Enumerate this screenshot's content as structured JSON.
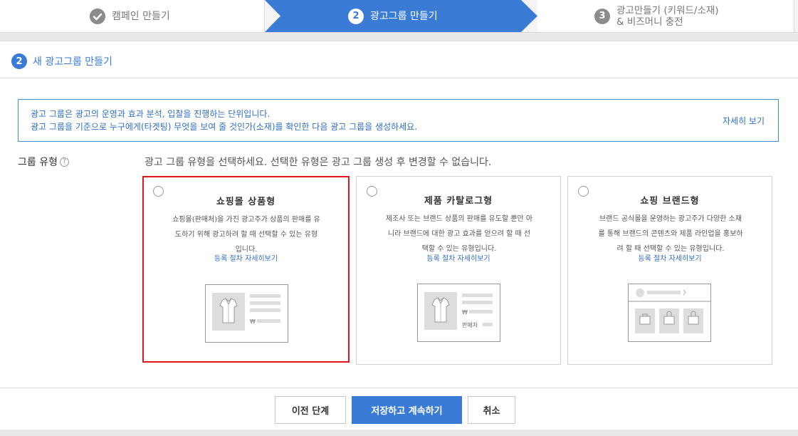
{
  "stepper": {
    "steps": [
      {
        "number": "✔",
        "label": "캠페인 만들기",
        "state": "done"
      },
      {
        "number": "2",
        "label": "광고그룹 만들기",
        "state": "active"
      },
      {
        "number": "3",
        "label_line1": "광고만들기 (키워드/소재)",
        "label_line2": "& 비즈머니 충전",
        "state": "pending"
      }
    ]
  },
  "section": {
    "number": "2",
    "title": "새 광고그룹 만들기"
  },
  "info": {
    "line1": "광고 그룹은 광고의 운영과 효과 분석, 입찰을 진행하는 단위입니다.",
    "line2": "광고 그룹을 기준으로 누구에게(타겟팅) 무엇을 보여 줄 것인가(소재)를 확인한 다음 광고 그룹을 생성하세요.",
    "detail_link": "자세히 보기"
  },
  "group_type": {
    "label": "그룹 유형",
    "help": "?",
    "description": "광고 그룹 유형을 선택하세요. 선택한 유형은 광고 그룹 생성 후 변경할 수 없습니다."
  },
  "cards": [
    {
      "title": "쇼핑몰 상품형",
      "desc_lines": [
        "쇼핑몰(판매처)을 가진 광고주가 상품의 판매를 유",
        "도하기 위해 광고하려 할 때 선택할 수 있는 유형",
        "입니다."
      ],
      "link": "등록 절차 자세히보기",
      "price_symbol": "₩",
      "highlighted": true
    },
    {
      "title": "제품 카탈로그형",
      "desc_lines": [
        "제조사 또는 브랜드 상품의 판매를 유도할 뿐만 아",
        "니라 브랜드에 대한 광고 효과를 얻으려 할 때 선",
        "택할 수 있는 유형입니다."
      ],
      "link": "등록 절차 자세히보기",
      "price_symbol": "₩",
      "seller_label": "판매처",
      "highlighted": false
    },
    {
      "title": "쇼핑 브랜드형",
      "desc_lines": [
        "브랜드 공식몰을 운영하는 광고주가 다양한 소재",
        "를 통해 브랜드의 콘텐츠와 제품 라인업을 홍보하",
        "려 할 때 선택할 수 있는 유형입니다."
      ],
      "link": "등록 절차 자세히보기",
      "highlighted": false
    }
  ],
  "buttons": {
    "prev": "이전 단계",
    "save": "저장하고 계속하기",
    "cancel": "취소"
  },
  "colors": {
    "accent": "#3a7bd5",
    "highlight": "#e0161b",
    "link": "#2f6fc1"
  }
}
